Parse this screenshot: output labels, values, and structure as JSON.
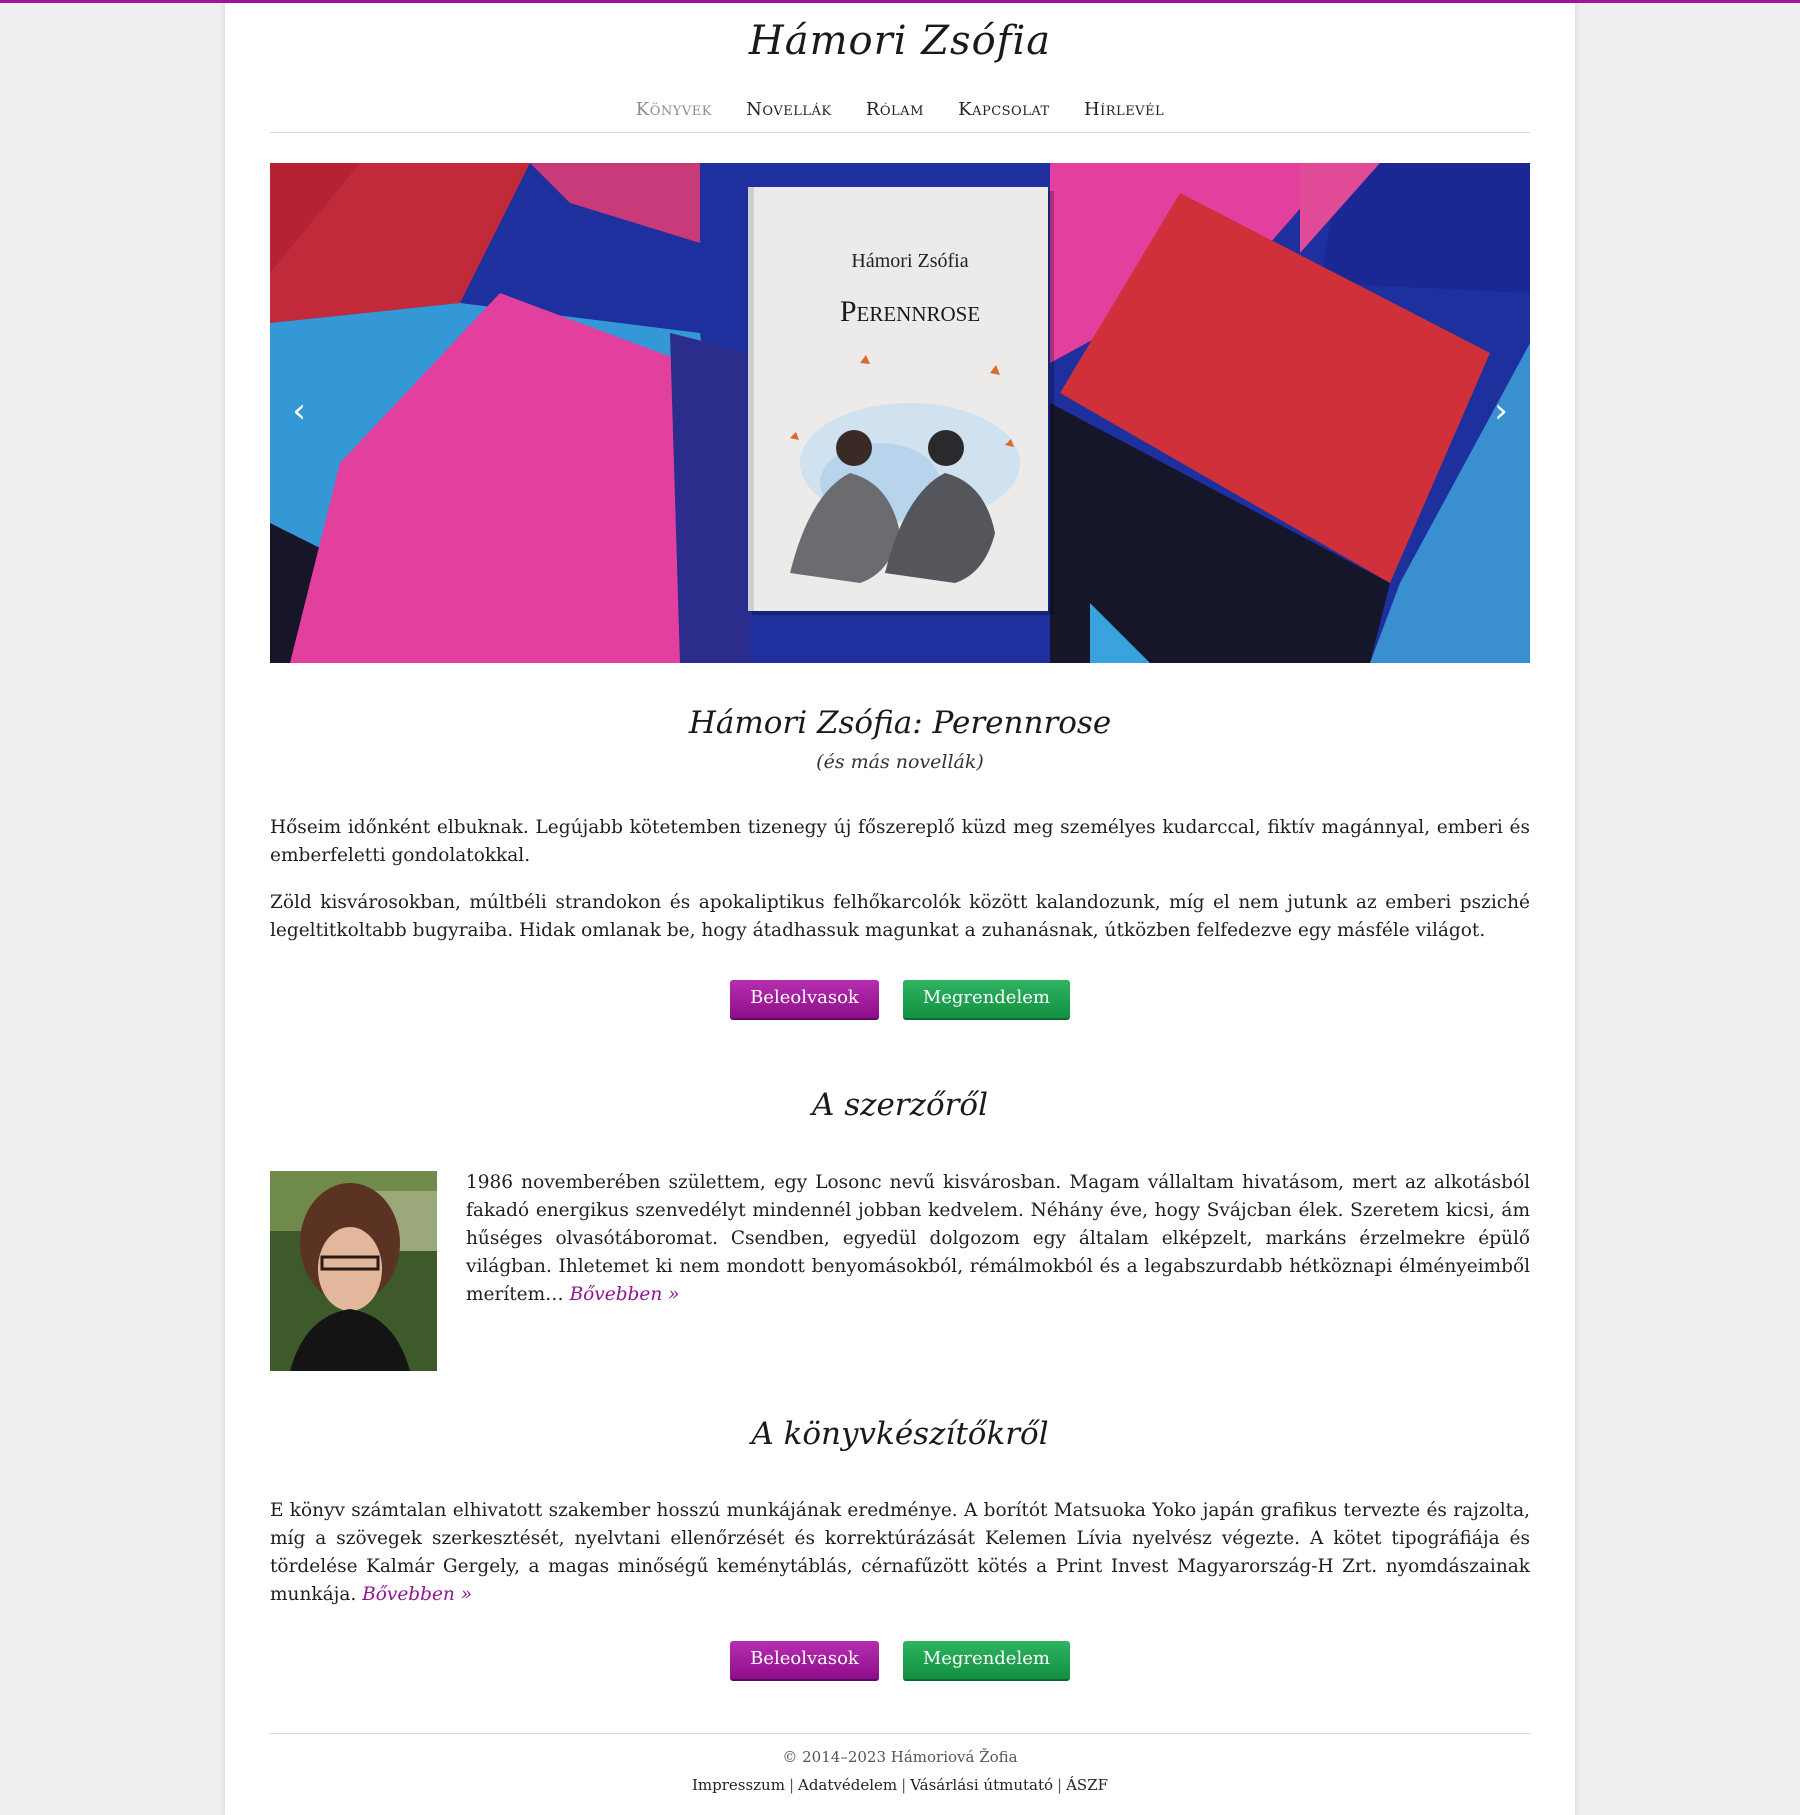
{
  "site": {
    "title": "Hámori Zsófia"
  },
  "nav": {
    "items": [
      {
        "label": "Könyvek"
      },
      {
        "label": "Novellák"
      },
      {
        "label": "Rólam"
      },
      {
        "label": "Kapcsolat"
      },
      {
        "label": "Hírlevél"
      }
    ]
  },
  "slider": {
    "cover_author": "Hámori Zsófia",
    "cover_title": "Perennrose",
    "prev_icon": "chevron-left-icon",
    "next_icon": "chevron-right-icon"
  },
  "book": {
    "title": "Hámori Zsófia: Perennrose",
    "subtitle": "(és más novellák)",
    "paragraph1": "Hőseim időnként elbuknak. Legújabb kötetemben tizenegy új főszereplő küzd meg személyes kudarccal, fiktív magánnyal, emberi és emberfeletti gondolatokkal.",
    "paragraph2": "Zöld kisvárosokban, múltbéli strandokon és apokaliptikus felhőkarcolók között kalandozunk, míg el nem jutunk az emberi psziché legeltitkoltabb bugyraiba. Hidak omlanak be, hogy átadhassuk magunkat a zuhanásnak, útközben felfedezve egy másféle világot."
  },
  "buttons": {
    "read_label": "Beleolvasok",
    "order_label": "Megrendelem"
  },
  "author": {
    "heading": "A szerzőről",
    "text": "1986 novemberében születtem, egy Losonc nevű kisvárosban. Magam vállaltam hivatásom, mert az alkotásból fakadó energikus szenvedélyt mindennél jobban kedvelem. Néhány éve, hogy Svájcban élek. Szeretem kicsi, ám hűséges olvasótáboromat. Csendben, egyedül dolgozom egy általam elképzelt, markáns érzelmekre épülő világban. Ihletemet ki nem mondott benyomásokból, rémálmokból és a legabszurdabb hétköznapi élményeimből merítem…",
    "more_label": "Bővebben »"
  },
  "makers": {
    "heading": "A könyvkészítőkről",
    "text": "E könyv számtalan elhivatott szakember hosszú munkájának eredménye. A borítót Matsuoka Yoko japán grafikus tervezte és rajzolta, míg a szövegek szerkesztését, nyelvtani ellenőrzését és korrektúrázását Kelemen Lívia nyelvész végezte. A kötet tipográfiája és tördelése Kalmár Gergely, a magas minőségű keménytáblás, cérnafűzött kötés a Print Invest Magyarország-H Zrt. nyomdászainak munkája.",
    "more_label": "Bővebben »"
  },
  "footer": {
    "copyright": "© 2014–2023 Hámoriová Žofia",
    "links": [
      {
        "label": "Impresszum"
      },
      {
        "label": "Adatvédelem"
      },
      {
        "label": "Vásárlási útmutató"
      },
      {
        "label": "ÁSZF"
      }
    ]
  },
  "colors": {
    "accent": "#8d1591",
    "button_purple": "#9c1699",
    "button_green": "#1ea14f"
  }
}
